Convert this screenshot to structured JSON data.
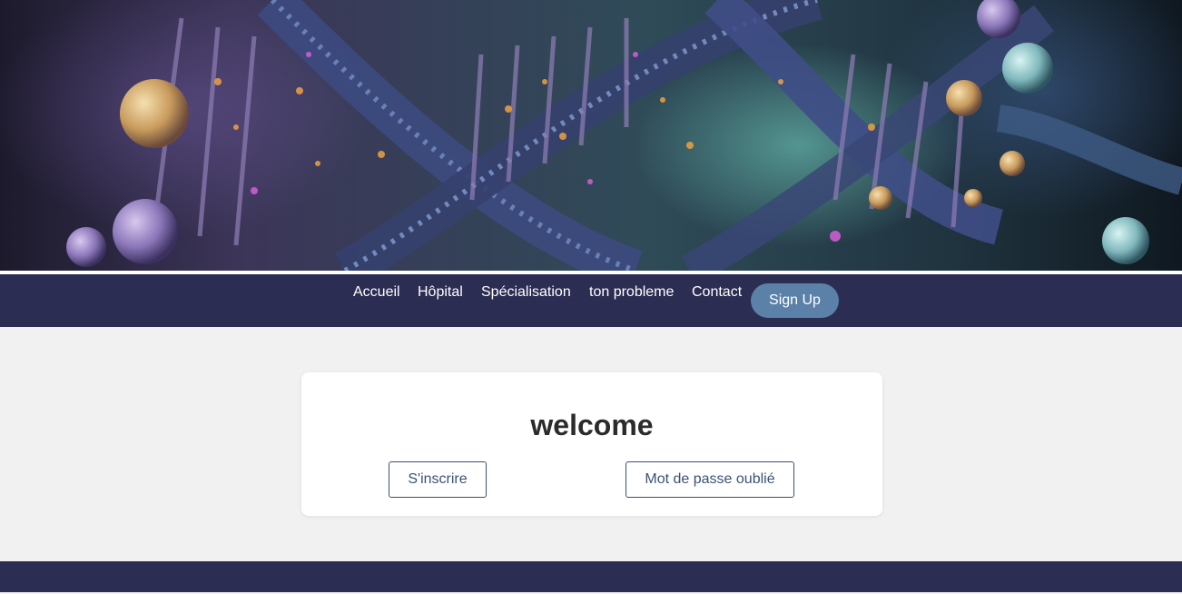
{
  "nav": {
    "items": [
      "Accueil",
      "Hôpital",
      "Spécialisation",
      "ton probleme",
      "Contact"
    ],
    "signup_label": "Sign Up"
  },
  "card": {
    "title": "welcome",
    "register_label": "S'inscrire",
    "forgot_password_label": "Mot de passe oublié"
  },
  "colors": {
    "navbar": "#2c2d53",
    "signup_button": "#5b81a8",
    "button_border": "#3b5272",
    "background": "#f1f1f1"
  },
  "hero": {
    "image": "dna-helix-banner"
  }
}
